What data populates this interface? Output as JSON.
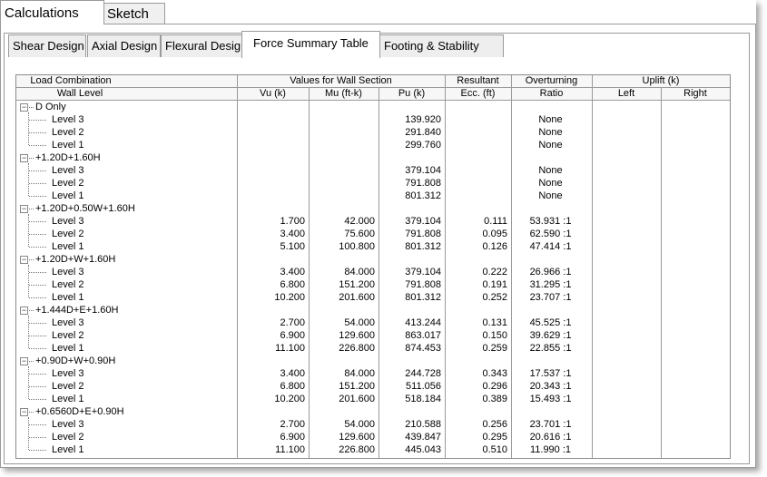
{
  "top_tabs": [
    {
      "label": "Calculations",
      "active": true
    },
    {
      "label": "Sketch",
      "active": false
    }
  ],
  "sub_tabs": [
    {
      "label": "Shear Design",
      "active": false
    },
    {
      "label": "Axial Design",
      "active": false
    },
    {
      "label": "Flexural Design",
      "active": false
    },
    {
      "label": "Force Summary Table",
      "active": true
    },
    {
      "label": "Footing & Stability",
      "active": false
    }
  ],
  "header_top": {
    "load_combination": "Load Combination",
    "values_for_wall_section": "Values for Wall Section",
    "resultant": "Resultant",
    "overturning": "Overturning",
    "uplift": "Uplift   (k)"
  },
  "header_bottom": {
    "wall_level": "Wall Level",
    "vu": "Vu   (k)",
    "mu": "Mu   (ft-k)",
    "pu": "Pu   (k)",
    "ecc": "Ecc.   (ft)",
    "ratio": "Ratio",
    "left": "Left",
    "right": "Right"
  },
  "groups": [
    {
      "name": "D Only",
      "rows": [
        {
          "level": "Level 3",
          "vu": "",
          "mu": "",
          "pu": "139.920",
          "ecc": "",
          "ratio": "None"
        },
        {
          "level": "Level 2",
          "vu": "",
          "mu": "",
          "pu": "291.840",
          "ecc": "",
          "ratio": "None"
        },
        {
          "level": "Level 1",
          "vu": "",
          "mu": "",
          "pu": "299.760",
          "ecc": "",
          "ratio": "None"
        }
      ]
    },
    {
      "name": "+1.20D+1.60H",
      "rows": [
        {
          "level": "Level 3",
          "vu": "",
          "mu": "",
          "pu": "379.104",
          "ecc": "",
          "ratio": "None"
        },
        {
          "level": "Level 2",
          "vu": "",
          "mu": "",
          "pu": "791.808",
          "ecc": "",
          "ratio": "None"
        },
        {
          "level": "Level 1",
          "vu": "",
          "mu": "",
          "pu": "801.312",
          "ecc": "",
          "ratio": "None"
        }
      ]
    },
    {
      "name": "+1.20D+0.50W+1.60H",
      "rows": [
        {
          "level": "Level 3",
          "vu": "1.700",
          "mu": "42.000",
          "pu": "379.104",
          "ecc": "0.111",
          "ratio": "53.931 :1"
        },
        {
          "level": "Level 2",
          "vu": "3.400",
          "mu": "75.600",
          "pu": "791.808",
          "ecc": "0.095",
          "ratio": "62.590 :1"
        },
        {
          "level": "Level 1",
          "vu": "5.100",
          "mu": "100.800",
          "pu": "801.312",
          "ecc": "0.126",
          "ratio": "47.414 :1"
        }
      ]
    },
    {
      "name": "+1.20D+W+1.60H",
      "rows": [
        {
          "level": "Level 3",
          "vu": "3.400",
          "mu": "84.000",
          "pu": "379.104",
          "ecc": "0.222",
          "ratio": "26.966 :1"
        },
        {
          "level": "Level 2",
          "vu": "6.800",
          "mu": "151.200",
          "pu": "791.808",
          "ecc": "0.191",
          "ratio": "31.295 :1"
        },
        {
          "level": "Level 1",
          "vu": "10.200",
          "mu": "201.600",
          "pu": "801.312",
          "ecc": "0.252",
          "ratio": "23.707 :1"
        }
      ]
    },
    {
      "name": "+1.444D+E+1.60H",
      "rows": [
        {
          "level": "Level 3",
          "vu": "2.700",
          "mu": "54.000",
          "pu": "413.244",
          "ecc": "0.131",
          "ratio": "45.525 :1"
        },
        {
          "level": "Level 2",
          "vu": "6.900",
          "mu": "129.600",
          "pu": "863.017",
          "ecc": "0.150",
          "ratio": "39.629 :1"
        },
        {
          "level": "Level 1",
          "vu": "11.100",
          "mu": "226.800",
          "pu": "874.453",
          "ecc": "0.259",
          "ratio": "22.855 :1"
        }
      ]
    },
    {
      "name": "+0.90D+W+0.90H",
      "rows": [
        {
          "level": "Level 3",
          "vu": "3.400",
          "mu": "84.000",
          "pu": "244.728",
          "ecc": "0.343",
          "ratio": "17.537 :1"
        },
        {
          "level": "Level 2",
          "vu": "6.800",
          "mu": "151.200",
          "pu": "511.056",
          "ecc": "0.296",
          "ratio": "20.343 :1"
        },
        {
          "level": "Level 1",
          "vu": "10.200",
          "mu": "201.600",
          "pu": "518.184",
          "ecc": "0.389",
          "ratio": "15.493 :1"
        }
      ]
    },
    {
      "name": "+0.6560D+E+0.90H",
      "rows": [
        {
          "level": "Level 3",
          "vu": "2.700",
          "mu": "54.000",
          "pu": "210.588",
          "ecc": "0.256",
          "ratio": "23.701 :1"
        },
        {
          "level": "Level 2",
          "vu": "6.900",
          "mu": "129.600",
          "pu": "439.847",
          "ecc": "0.295",
          "ratio": "20.616 :1"
        },
        {
          "level": "Level 1",
          "vu": "11.100",
          "mu": "226.800",
          "pu": "445.043",
          "ecc": "0.510",
          "ratio": "11.990 :1"
        }
      ]
    }
  ]
}
